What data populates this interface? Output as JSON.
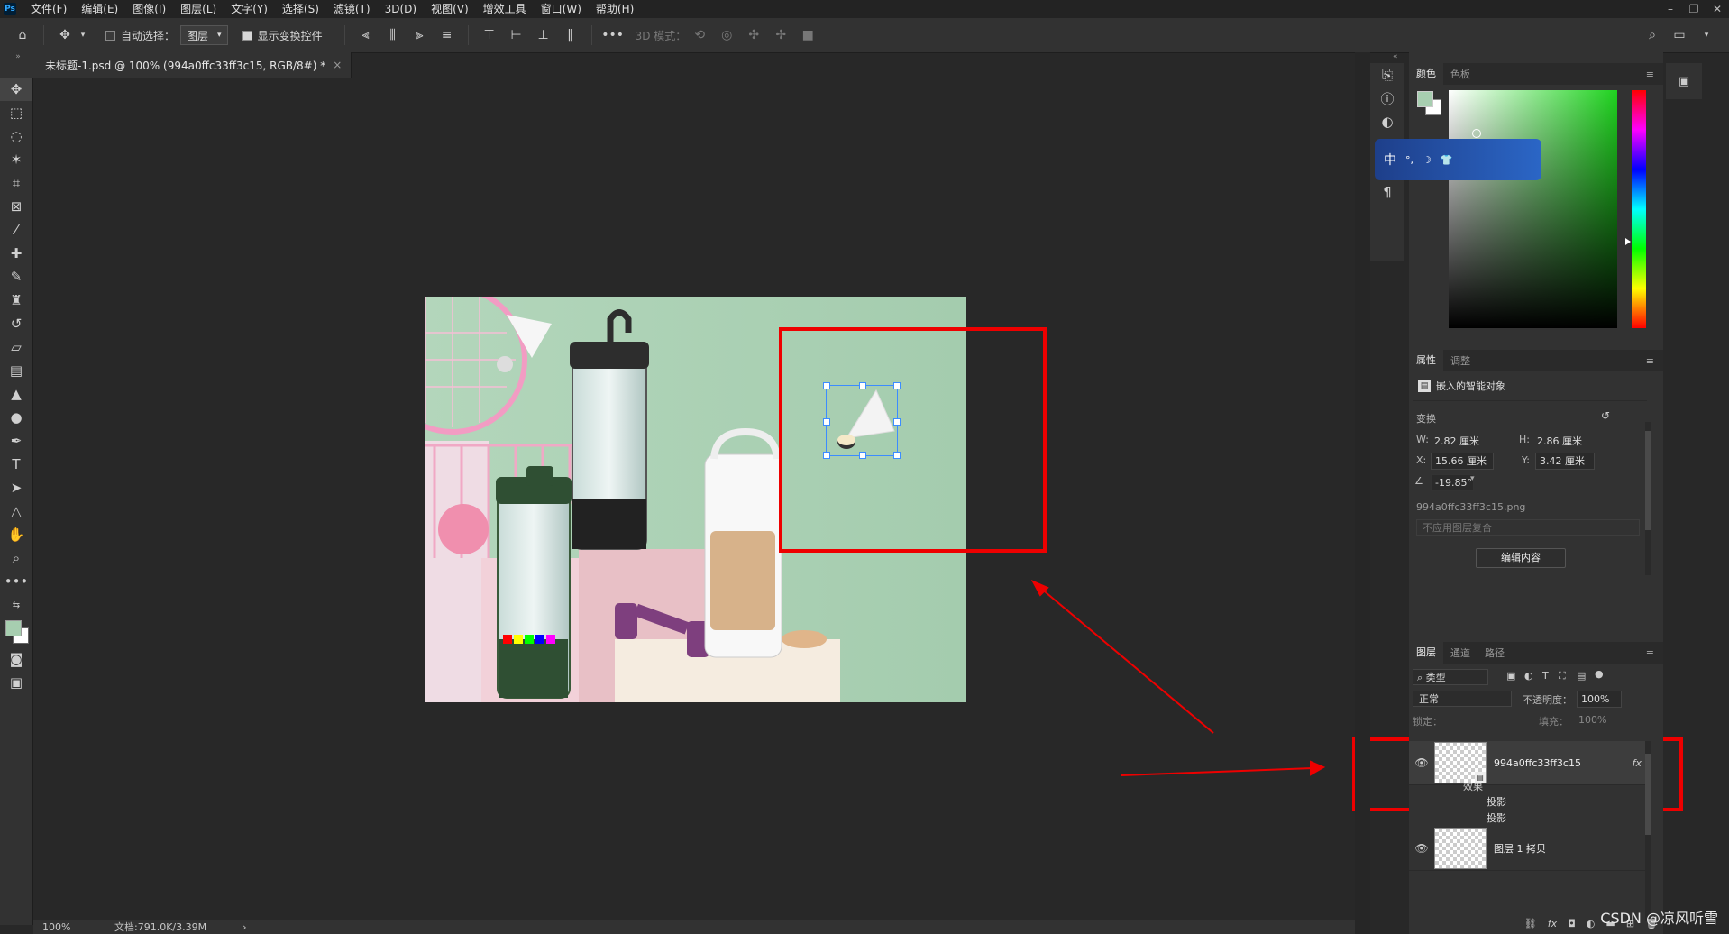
{
  "menubar": {
    "logo": "Ps",
    "items": [
      "文件(F)",
      "编辑(E)",
      "图像(I)",
      "图层(L)",
      "文字(Y)",
      "选择(S)",
      "滤镜(T)",
      "3D(D)",
      "视图(V)",
      "增效工具",
      "窗口(W)",
      "帮助(H)"
    ]
  },
  "options": {
    "auto_select_label": "自动选择：",
    "layer_select": "图层",
    "show_transform_label": "显示变换控件",
    "mode3d_label": "3D 模式："
  },
  "document_tab": {
    "title": "未标题-1.psd @ 100% (994a0ffc33ff3c15, RGB/8#) *",
    "close": "×"
  },
  "status": {
    "zoom": "100%",
    "doc_info": "文档:791.0K/3.39M",
    "arrow": "›"
  },
  "color_panel": {
    "tabs": [
      "颜色",
      "色板"
    ],
    "fg_color": "#a7ceb0",
    "bg_color": "#ffffff",
    "hue_color": "#1fd21f"
  },
  "ime_bar": {
    "label": "中"
  },
  "properties": {
    "tabs": [
      "属性",
      "调整"
    ],
    "object_type": "嵌入的智能对象",
    "transform_label": "变换",
    "w_label": "W:",
    "w": "2.82 厘米",
    "h_label": "H:",
    "h": "2.86 厘米",
    "x_label": "X:",
    "x": "15.66 厘米",
    "y_label": "Y:",
    "y": "3.42 厘米",
    "angle": "-19.85°",
    "filename": "994a0ffc33ff3c15.png",
    "comp_placeholder": "不应用图层复合",
    "edit_button": "编辑内容"
  },
  "layers": {
    "tabs": [
      "图层",
      "通道",
      "路径"
    ],
    "filter": "类型",
    "blend_mode": "正常",
    "opacity_label": "不透明度：",
    "opacity": "100%",
    "lock_label": "锁定：",
    "fill_label": "填充：",
    "fill": "100%",
    "items": [
      {
        "name": "994a0ffc33ff3c15",
        "fx": "fx"
      },
      {
        "name": "图层 1 拷贝"
      }
    ],
    "effects_label": "效果",
    "effects": [
      "投影",
      "投影"
    ]
  },
  "watermark": "CSDN @凉风听雪"
}
